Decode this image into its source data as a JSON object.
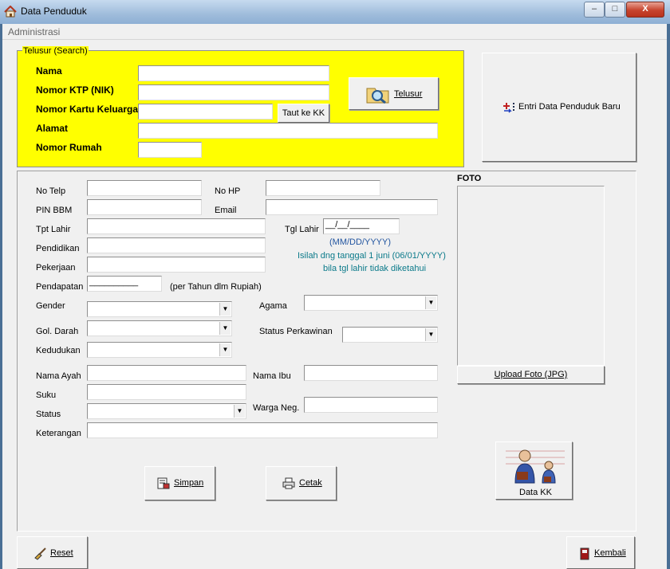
{
  "window": {
    "title": "Data Penduduk",
    "minimize": "–",
    "maximize": "□",
    "close": "X"
  },
  "menu": {
    "administrasi": "Administrasi"
  },
  "search": {
    "legend": "Telusur (Search)",
    "nama_label": "Nama",
    "ktp_label": "Nomor KTP (NIK)",
    "kk_label": "Nomor Kartu Keluarga",
    "alamat_label": "Alamat",
    "rumah_label": "Nomor Rumah",
    "taut_kk_label": "Taut ke KK",
    "telusur_label": "Telusur"
  },
  "entri_baru_label": "Entri Data Penduduk Baru",
  "form": {
    "no_telp": "No Telp",
    "no_hp": "No HP",
    "pin_bbm": "PIN BBM",
    "email": "Email",
    "tpt_lahir": "Tpt Lahir",
    "tgl_lahir": "Tgl Lahir",
    "tgl_lahir_value": "__/__/____",
    "date_format": "(MM/DD/YYYY)",
    "date_hint1": "Isilah dng tanggal 1 juni (06/01/YYYY)",
    "date_hint2": "bila tgl lahir tidak diketahui",
    "pendidikan": "Pendidikan",
    "pekerjaan": "Pekerjaan",
    "pendapatan": "Pendapatan",
    "pendapatan_value": "__________",
    "pendapatan_note": "(per Tahun dlm Rupiah)",
    "gender": "Gender",
    "agama": "Agama",
    "gol_darah": "Gol. Darah",
    "status_perkawinan": "Status Perkawinan",
    "kedudukan": "Kedudukan",
    "nama_ayah": "Nama Ayah",
    "nama_ibu": "Nama Ibu",
    "suku": "Suku",
    "status": "Status",
    "warga_neg": "Warga Neg.",
    "keterangan": "Keterangan"
  },
  "foto": {
    "title": "FOTO",
    "upload_label": "Upload Foto (JPG)"
  },
  "actions": {
    "simpan": "Simpan",
    "cetak": "Cetak",
    "data_kk": "Data KK",
    "reset": "Reset",
    "kembali": "Kembali"
  }
}
